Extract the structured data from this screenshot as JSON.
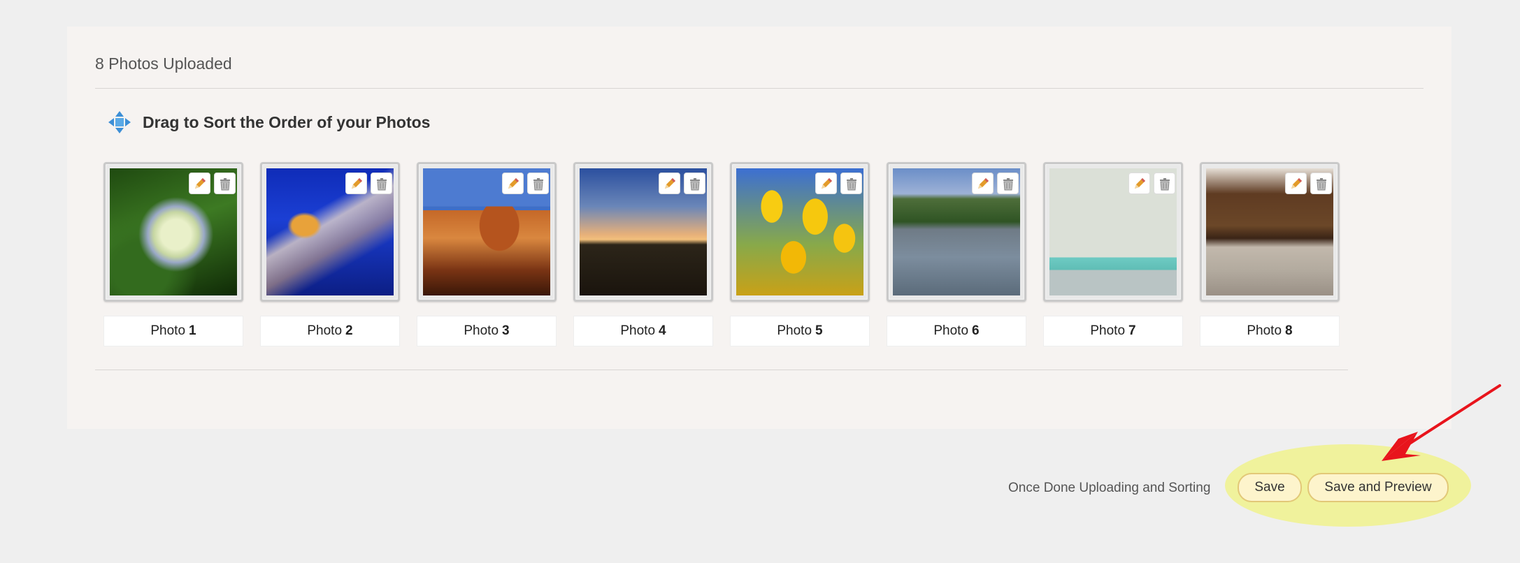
{
  "panel": {
    "title": "8 Photos Uploaded",
    "sort_heading": "Drag to Sort the Order of your Photos"
  },
  "photos": [
    {
      "label": "Photo",
      "number": "1"
    },
    {
      "label": "Photo",
      "number": "2"
    },
    {
      "label": "Photo",
      "number": "3"
    },
    {
      "label": "Photo",
      "number": "4"
    },
    {
      "label": "Photo",
      "number": "5"
    },
    {
      "label": "Photo",
      "number": "6"
    },
    {
      "label": "Photo",
      "number": "7"
    },
    {
      "label": "Photo",
      "number": "8"
    }
  ],
  "icons": {
    "sort": "move-arrows-icon",
    "edit": "pencil-icon",
    "delete": "trash-icon"
  },
  "footer": {
    "instruction": "Once Done Uploading and Sorting",
    "save_label": "Save",
    "save_preview_label": "Save and Preview"
  },
  "colors": {
    "highlight": "#f0f29c",
    "annotation_arrow": "#e8141c",
    "button_border": "#e2c877"
  }
}
